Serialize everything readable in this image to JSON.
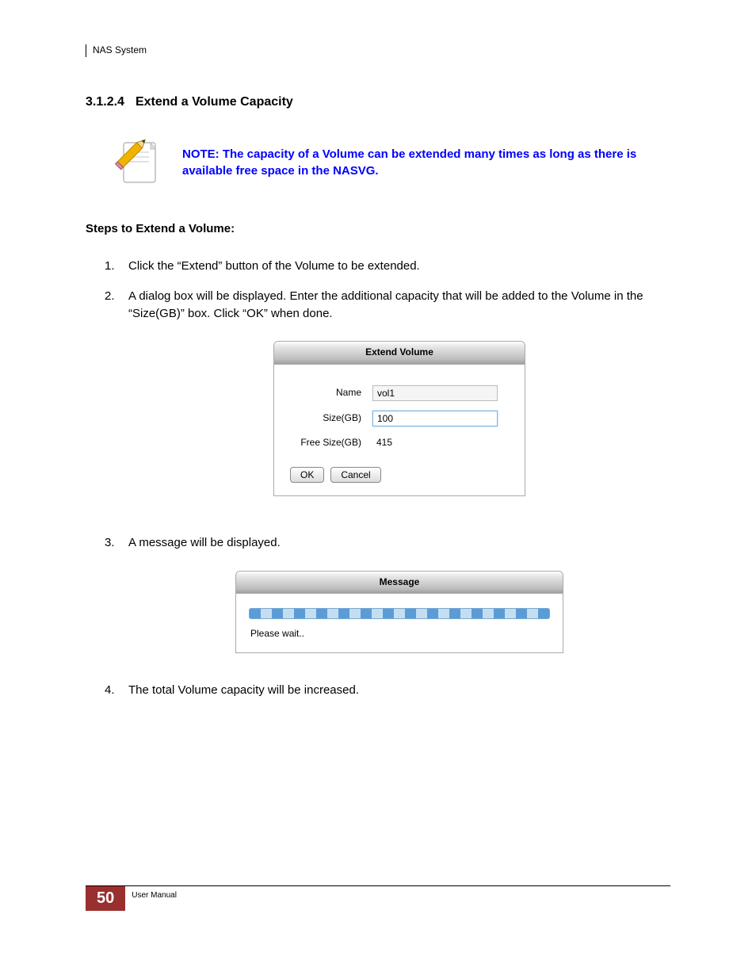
{
  "header": {
    "system_name": "NAS System"
  },
  "section": {
    "number": "3.1.2.4",
    "title": "Extend a Volume Capacity"
  },
  "note": {
    "text": "NOTE: The capacity of a Volume can be extended many times as long as there is available free space in the NASVG."
  },
  "steps_heading": "Steps to Extend a Volume:",
  "steps": {
    "s1": "Click the “Extend” button of the Volume to be extended.",
    "s2": "A dialog box will be displayed. Enter the additional capacity that will be added to the Volume in the “Size(GB)” box. Click “OK” when done.",
    "s3": "A message will be displayed.",
    "s4": "The total Volume capacity will be increased."
  },
  "extend_dialog": {
    "title": "Extend Volume",
    "name_label": "Name",
    "name_value": "vol1",
    "size_label": "Size(GB)",
    "size_value": "100",
    "free_label": "Free Size(GB)",
    "free_value": "415",
    "ok": "OK",
    "cancel": "Cancel"
  },
  "message_dialog": {
    "title": "Message",
    "text": "Please wait.."
  },
  "footer": {
    "page": "50",
    "label": "User Manual"
  }
}
